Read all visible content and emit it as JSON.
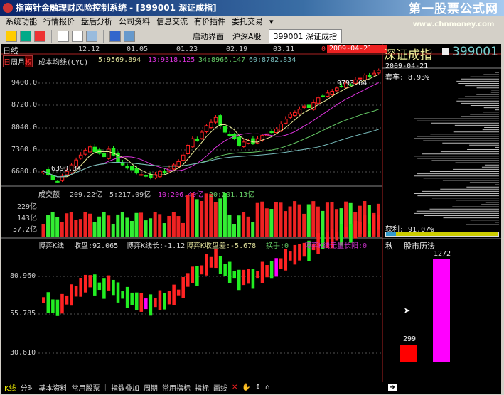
{
  "window": {
    "title": "指南针金融理财风险控制系统 - [399001 深证成指]",
    "watermark": "第一股票公式网",
    "watermark_url": "www.chnmoney.com"
  },
  "menu": [
    "系统功能",
    "行情报价",
    "盘后分析",
    "公司资料",
    "信息交流",
    "有价插件",
    "委托交易"
  ],
  "toolbar": {
    "start": "启动界面",
    "hs": "沪深A股",
    "current": "399001  深证成指"
  },
  "chart": {
    "period": "日线",
    "period_tabs": [
      "日",
      "周",
      "月",
      "权"
    ],
    "dates": [
      "12.12",
      "01.05",
      "01.23",
      "02.19",
      "03.11"
    ],
    "cur_date": "2009-04-21",
    "cur_val": "0",
    "ma_title": "成本均线(CYC)",
    "ma": [
      "5:9569.894",
      "13:9318.125",
      "34:8966.147",
      "60:8782.834"
    ],
    "price_ticks": [
      "9400.0",
      "8720.0",
      "8040.0",
      "7360.0",
      "6680.0"
    ],
    "high_label": "9793.64",
    "low_label": "6390.34",
    "vol_title": "成交额",
    "vol": [
      "209.22亿",
      "5:217.09亿",
      "10:206.40亿",
      "20:201.13亿"
    ],
    "vol_ticks": [
      "229亿",
      "143亿",
      "57.2亿"
    ],
    "ind": [
      "博弈K线",
      "收盘:92.065",
      "博弈K线长:-1.12",
      "博弈K收盘差:-5.678",
      "换手:0",
      "博弈K线无量长阳:0"
    ],
    "ind_ticks": [
      "80.960",
      "55.785",
      "30.610"
    ]
  },
  "chart_data": {
    "type": "candlestick",
    "closes": [
      6700,
      6600,
      6450,
      6390,
      6550,
      6700,
      6900,
      7050,
      7200,
      7350,
      7450,
      7300,
      7250,
      7150,
      7380,
      7200,
      7000,
      6900,
      6800,
      6750,
      6650,
      6600,
      6550,
      6500,
      6600,
      6700,
      6650,
      6800,
      6900,
      7000,
      7200,
      7500,
      7700,
      7650,
      7900,
      8100,
      8200,
      8350,
      8100,
      7900,
      7800,
      7700,
      7500,
      7600,
      7650,
      7550,
      7700,
      7800,
      7850,
      7900,
      8000,
      8150,
      8300,
      8450,
      8500,
      8600,
      8700,
      8650,
      8800,
      8950,
      9000,
      9100,
      9150,
      9250,
      9300,
      9400,
      9350,
      9500,
      9550,
      9650,
      9600,
      9700,
      9793
    ]
  },
  "right": {
    "name": "深证成指",
    "code": "399001",
    "date": "2009-04-21",
    "trap": "套牢: 8.93%",
    "profit": "获利: 91.07%",
    "profit_pct": 91.07,
    "season": "秋",
    "calendar": "股市历法",
    "bar_red": "299",
    "bar_magenta": "1272"
  },
  "bottom": [
    "K线",
    "分时",
    "基本资料",
    "常用股票",
    "指数叠加",
    "周期",
    "常用指标",
    "指标",
    "画线"
  ]
}
